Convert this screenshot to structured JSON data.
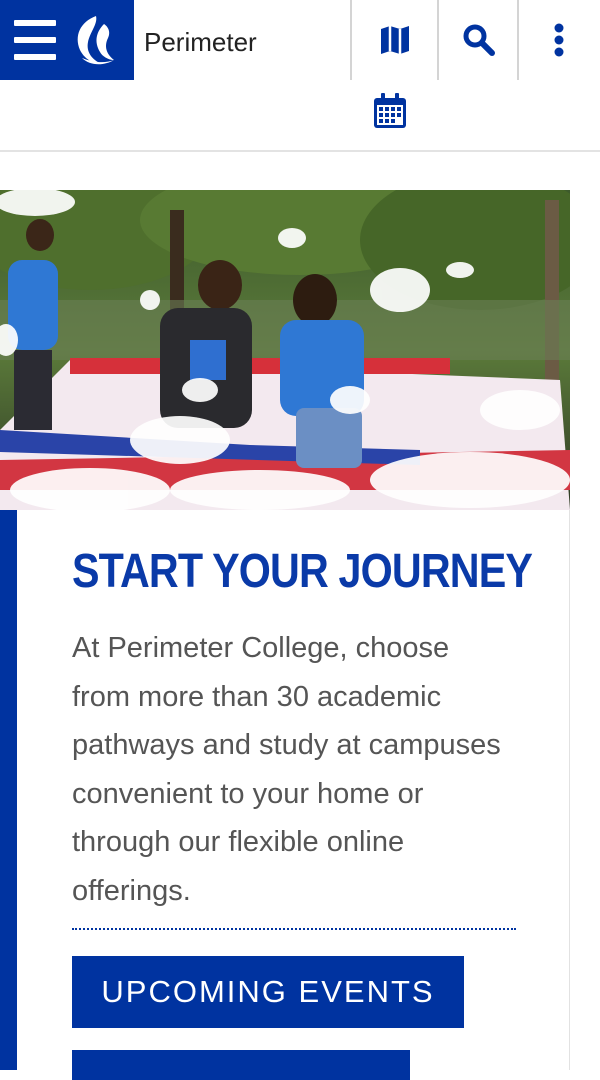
{
  "header": {
    "site_name": "Perimeter",
    "brand_color": "#0033a0",
    "icons": [
      "menu-icon",
      "flame-logo-icon",
      "map-icon",
      "search-icon",
      "more-vertical-icon",
      "calendar-icon"
    ]
  },
  "hero": {
    "image_subject": "students playing in foam pit"
  },
  "card": {
    "title": "START YOUR JOURNEY",
    "body": "At Perimeter College, choose from more than 30 academic pathways and study at campuses convenient to your home or through our flexible online offerings.",
    "primary_button": "UPCOMING EVENTS"
  }
}
